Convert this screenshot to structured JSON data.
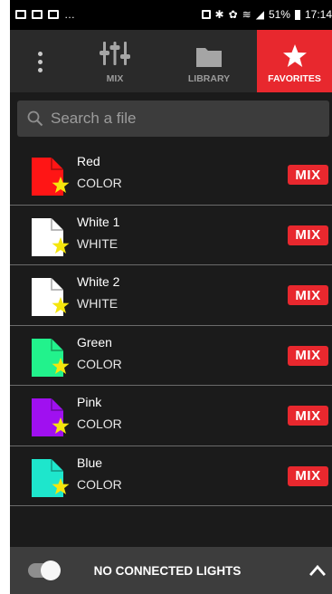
{
  "status_bar": {
    "battery": "51%",
    "time": "17:14"
  },
  "toolbar": {
    "tabs": [
      {
        "label": "MIX",
        "icon": "sliders-icon"
      },
      {
        "label": "LIBRARY",
        "icon": "folder-icon"
      },
      {
        "label": "FAVORITES",
        "icon": "star-icon",
        "selected": true
      }
    ]
  },
  "search": {
    "placeholder": "Search a file"
  },
  "files": [
    {
      "name": "Red",
      "type": "COLOR",
      "color": "#ff1515",
      "favorite": true,
      "action": "MIX"
    },
    {
      "name": "White 1",
      "type": "WHITE",
      "color": "#ffffff",
      "favorite": true,
      "action": "MIX"
    },
    {
      "name": "White 2",
      "type": "WHITE",
      "color": "#ffffff",
      "favorite": true,
      "action": "MIX"
    },
    {
      "name": "Green",
      "type": "COLOR",
      "color": "#22f28c",
      "favorite": true,
      "action": "MIX"
    },
    {
      "name": "Pink",
      "type": "COLOR",
      "color": "#a010f0",
      "favorite": true,
      "action": "MIX"
    },
    {
      "name": "Blue",
      "type": "COLOR",
      "color": "#1ee6cc",
      "favorite": true,
      "action": "MIX"
    }
  ],
  "bottom_bar": {
    "label": "NO CONNECTED LIGHTS"
  },
  "colors": {
    "accent": "#e8282e",
    "star": "#f5e60d",
    "background": "#1b1b1b"
  }
}
